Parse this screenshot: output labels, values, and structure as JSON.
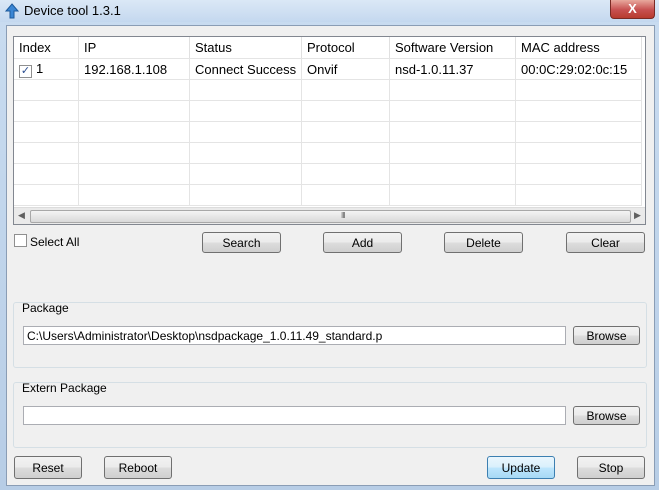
{
  "window": {
    "title": "Device tool 1.3.1",
    "close_label": "X"
  },
  "grid": {
    "columns": [
      "Index",
      "IP",
      "Status",
      "Protocol",
      "Software Version",
      "MAC address"
    ],
    "rows": [
      {
        "checked": true,
        "index": "1",
        "ip": "192.168.1.108",
        "status": "Connect Success",
        "protocol": "Onvif",
        "version": "nsd-1.0.11.37",
        "mac": "00:0C:29:02:0c:15"
      }
    ],
    "scroll_grip": "III"
  },
  "actions": {
    "select_all": "Select All",
    "search": "Search",
    "add": "Add",
    "delete": "Delete",
    "clear": "Clear"
  },
  "package": {
    "label": "Package",
    "value": "C:\\Users\\Administrator\\Desktop\\nsdpackage_1.0.11.49_standard.p",
    "browse": "Browse"
  },
  "extern_package": {
    "label": "Extern Package",
    "value": "",
    "browse": "Browse"
  },
  "footer": {
    "reset": "Reset",
    "reboot": "Reboot",
    "update": "Update",
    "stop": "Stop"
  }
}
